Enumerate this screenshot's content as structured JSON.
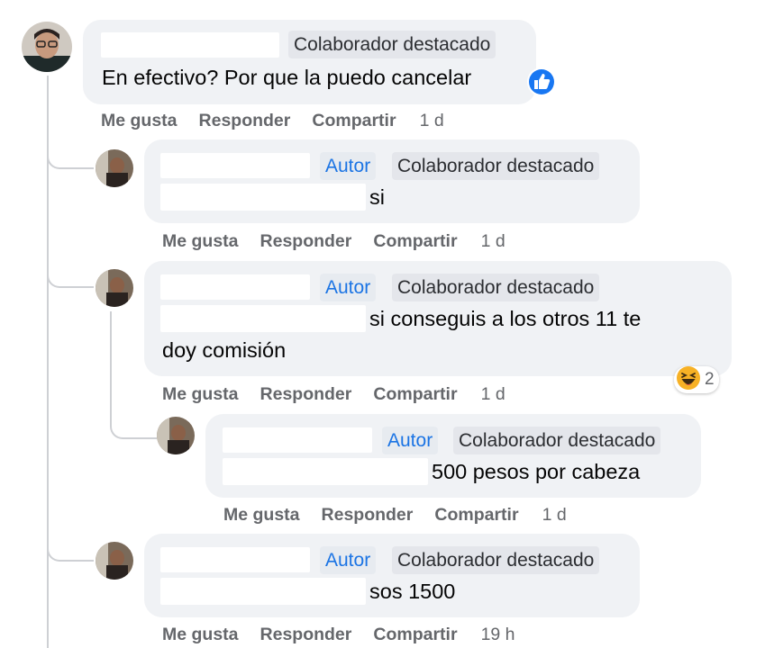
{
  "actions": {
    "like": "Me gusta",
    "reply": "Responder",
    "share": "Compartir"
  },
  "badges": {
    "author": "Autor",
    "collab": "Colaborador destacado"
  },
  "comments": [
    {
      "text": "En efectivo? Por que la puedo cancelar",
      "time": "1 d",
      "reaction": "like-icon"
    },
    {
      "text": "si",
      "time": "1 d"
    },
    {
      "text_line1": "si conseguis a los otros 11 te",
      "text_line2": "doy comisión",
      "time": "1 d",
      "reaction": "haha-icon",
      "reaction_count": "2"
    },
    {
      "text": "500 pesos por cabeza",
      "time": "1 d"
    },
    {
      "text": "sos 1500",
      "time": "19 h"
    }
  ],
  "colors": {
    "author": "#1b74e4",
    "like_blue": "#1877f2",
    "bubble": "#f0f2f5",
    "meta": "#65676b"
  }
}
